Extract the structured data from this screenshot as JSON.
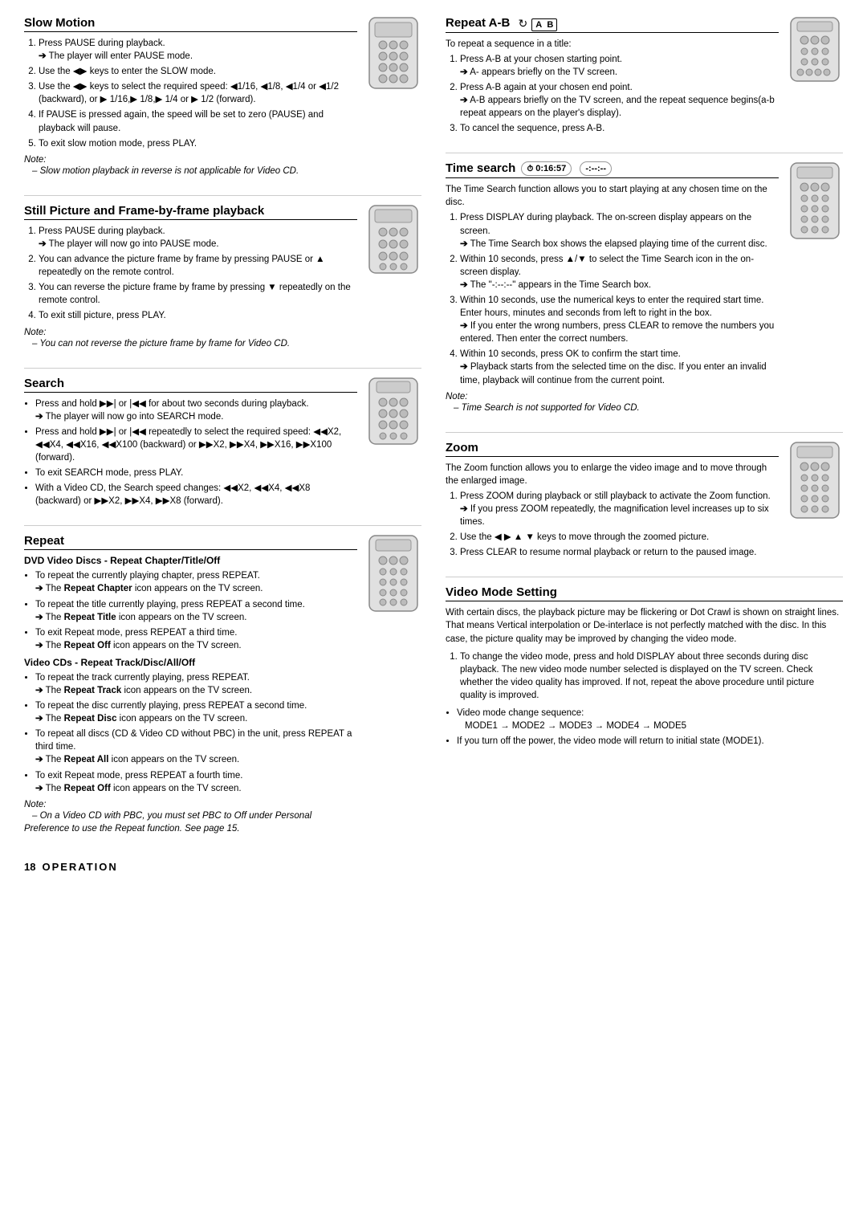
{
  "footer": {
    "page_num": "18",
    "label": "OPERATION"
  },
  "left_column": {
    "sections": [
      {
        "id": "slow-motion",
        "title": "Slow Motion",
        "steps": [
          {
            "num": 1,
            "text": "Press PAUSE during playback.",
            "arrow": "The player will enter PAUSE mode."
          },
          {
            "num": 2,
            "text": "Use the ◀▶ keys to enter the SLOW mode."
          },
          {
            "num": 3,
            "text": "Use the ◀▶ keys to select the required speed: ◀1/16, ◀1/8, ◀1/4 or ◀1/2 (backward), or ▶ 1/16,▶ 1/8,▶ 1/4 or ▶ 1/2 (forward)."
          },
          {
            "num": 4,
            "text": "If PAUSE is pressed again, the speed will be set to zero (PAUSE) and playback will pause."
          },
          {
            "num": 5,
            "text": "To exit slow motion mode, press PLAY."
          }
        ],
        "note": "– Slow motion playback in reverse is not applicable for Video CD."
      },
      {
        "id": "still-picture",
        "title": "Still Picture and Frame-by-frame playback",
        "steps": [
          {
            "num": 1,
            "text": "Press PAUSE during playback.",
            "arrow": "The player will now go into PAUSE mode."
          },
          {
            "num": 2,
            "text": "You can advance the picture frame by frame by pressing PAUSE or ▲ repeatedly on the remote control."
          },
          {
            "num": 3,
            "text": "You can reverse the picture frame by frame by pressing ▼ repeatedly on the remote control."
          },
          {
            "num": 4,
            "text": "To exit still picture, press PLAY."
          }
        ],
        "note": "– You can not reverse the picture frame by frame for Video CD."
      },
      {
        "id": "search",
        "title": "Search",
        "bullets": [
          {
            "text": "Press and hold ▶▶| or |◀◀ for about two seconds during playback.",
            "arrow": "The player will now go into SEARCH mode."
          },
          {
            "text": "Press and hold ▶▶| or |◀◀ repeatedly to select the required speed: ◀◀X2, ◀◀X4, ◀◀X16, ◀◀X100 (backward) or ▶▶X2, ▶▶X4, ▶▶X16, ▶▶X100 (forward)."
          },
          {
            "text": "To exit SEARCH mode, press PLAY."
          },
          {
            "text": "With a Video CD, the Search speed changes: ◀◀X2, ◀◀X4, ◀◀X8 (backward) or ▶▶X2, ▶▶X4, ▶▶X8 (forward)."
          }
        ]
      },
      {
        "id": "repeat",
        "title": "Repeat",
        "subtitle_dvd": "DVD Video Discs - Repeat Chapter/Title/Off",
        "dvd_bullets": [
          {
            "text": "To repeat the currently playing chapter, press REPEAT.",
            "arrow_bold": "Repeat Chapter",
            "arrow_suffix": "icon appears on the TV screen."
          },
          {
            "text": "To repeat the title currently playing, press REPEAT a second time.",
            "arrow_bold": "Repeat Title",
            "arrow_suffix": "icon appears on the TV screen."
          },
          {
            "text": "To exit Repeat mode, press REPEAT a third time.",
            "arrow_bold": "Repeat Off",
            "arrow_suffix": "icon appears on the TV screen."
          }
        ],
        "subtitle_vcd": "Video CDs - Repeat Track/Disc/All/Off",
        "vcd_bullets": [
          {
            "text": "To repeat the track currently playing, press REPEAT.",
            "arrow_bold": "Repeat Track",
            "arrow_suffix": "icon appears on the TV screen."
          },
          {
            "text": "To repeat the disc currently playing, press REPEAT a second time.",
            "arrow_bold": "Repeat Disc",
            "arrow_suffix": "icon appears on the TV screen."
          },
          {
            "text": "To repeat all discs (CD & Video CD without PBC) in the unit, press REPEAT a third time.",
            "arrow_bold": "Repeat All",
            "arrow_suffix": "icon appears on the TV screen."
          },
          {
            "text": "To exit Repeat mode, press REPEAT a fourth time.",
            "arrow_bold": "Repeat Off",
            "arrow_suffix": "icon appears on the TV screen."
          }
        ],
        "note": "– On a Video CD with PBC, you must set PBC to Off under Personal Preference to use the Repeat function. See page 15."
      }
    ]
  },
  "right_column": {
    "sections": [
      {
        "id": "repeat-ab",
        "title": "Repeat A-B",
        "intro": "To repeat a sequence in a title:",
        "steps": [
          {
            "num": 1,
            "text": "Press A-B at your chosen starting point.",
            "arrow": "A- appears briefly on the TV screen."
          },
          {
            "num": 2,
            "text": "Press A-B again at your chosen end point.",
            "arrow": "A-B appears briefly on the TV screen, and the repeat sequence begins(a-b repeat appears on the player's display)."
          },
          {
            "num": 3,
            "text": "To cancel the sequence, press A-B."
          }
        ]
      },
      {
        "id": "time-search",
        "title": "Time search",
        "time_display": "0:16:57",
        "time_display2": "-:--:--",
        "intro": "The Time Search function allows you to start playing at any chosen time on the disc.",
        "steps": [
          {
            "num": 1,
            "text": "Press DISPLAY during playback. The on-screen display appears on the screen.",
            "arrow": "The Time Search box shows the elapsed playing time of the current disc."
          },
          {
            "num": 2,
            "text": "Within 10 seconds, press ▲/▼ to select the Time Search icon in the on-screen display.",
            "arrow": "The \"-:--:--\" appears in the Time Search box."
          },
          {
            "num": 3,
            "text": "Within 10 seconds, use the numerical keys to enter the required start time. Enter hours, minutes and seconds from left to right in the box.",
            "arrow": "If you enter the wrong numbers, press CLEAR to remove the numbers you entered. Then enter the correct numbers."
          },
          {
            "num": 4,
            "text": "Within 10 seconds, press OK to confirm the start time.",
            "arrow": "Playback starts from the selected time on the disc. If you enter an invalid time, playback will continue from the current point."
          }
        ],
        "note": "– Time Search is not supported for Video CD."
      },
      {
        "id": "zoom",
        "title": "Zoom",
        "intro": "The Zoom function allows you to enlarge the video image and to move through the enlarged image.",
        "steps": [
          {
            "num": 1,
            "text": "Press ZOOM during playback or still playback to activate the Zoom function.",
            "arrow": "If you press ZOOM repeatedly, the magnification level increases up to six times."
          },
          {
            "num": 2,
            "text": "Use the ◀ ▶ ▲ ▼ keys to move through the zoomed picture."
          },
          {
            "num": 3,
            "text": "Press CLEAR to resume normal playback or return to the paused image."
          }
        ]
      },
      {
        "id": "video-mode",
        "title": "Video Mode Setting",
        "intro": "With certain discs, the playback picture may be flickering or Dot Crawl is shown on straight lines. That means Vertical interpolation or De-interlace is not perfectly matched with the disc. In this case, the picture quality may be improved by changing the video mode.",
        "steps": [
          {
            "num": 1,
            "text": "To change the video mode, press and hold DISPLAY about three seconds during disc playback. The new video mode number selected is displayed on the TV screen. Check whether the video quality has improved. If not, repeat the above procedure until picture quality is improved."
          }
        ],
        "bullets": [
          {
            "text": "Video mode change sequence:"
          },
          {
            "text": "If you turn off the power, the video mode will return to initial state (MODE1)."
          }
        ],
        "mode_sequence": "MODE1 → MODE2 → MODE3 → MODE4 → MODE5"
      }
    ]
  }
}
